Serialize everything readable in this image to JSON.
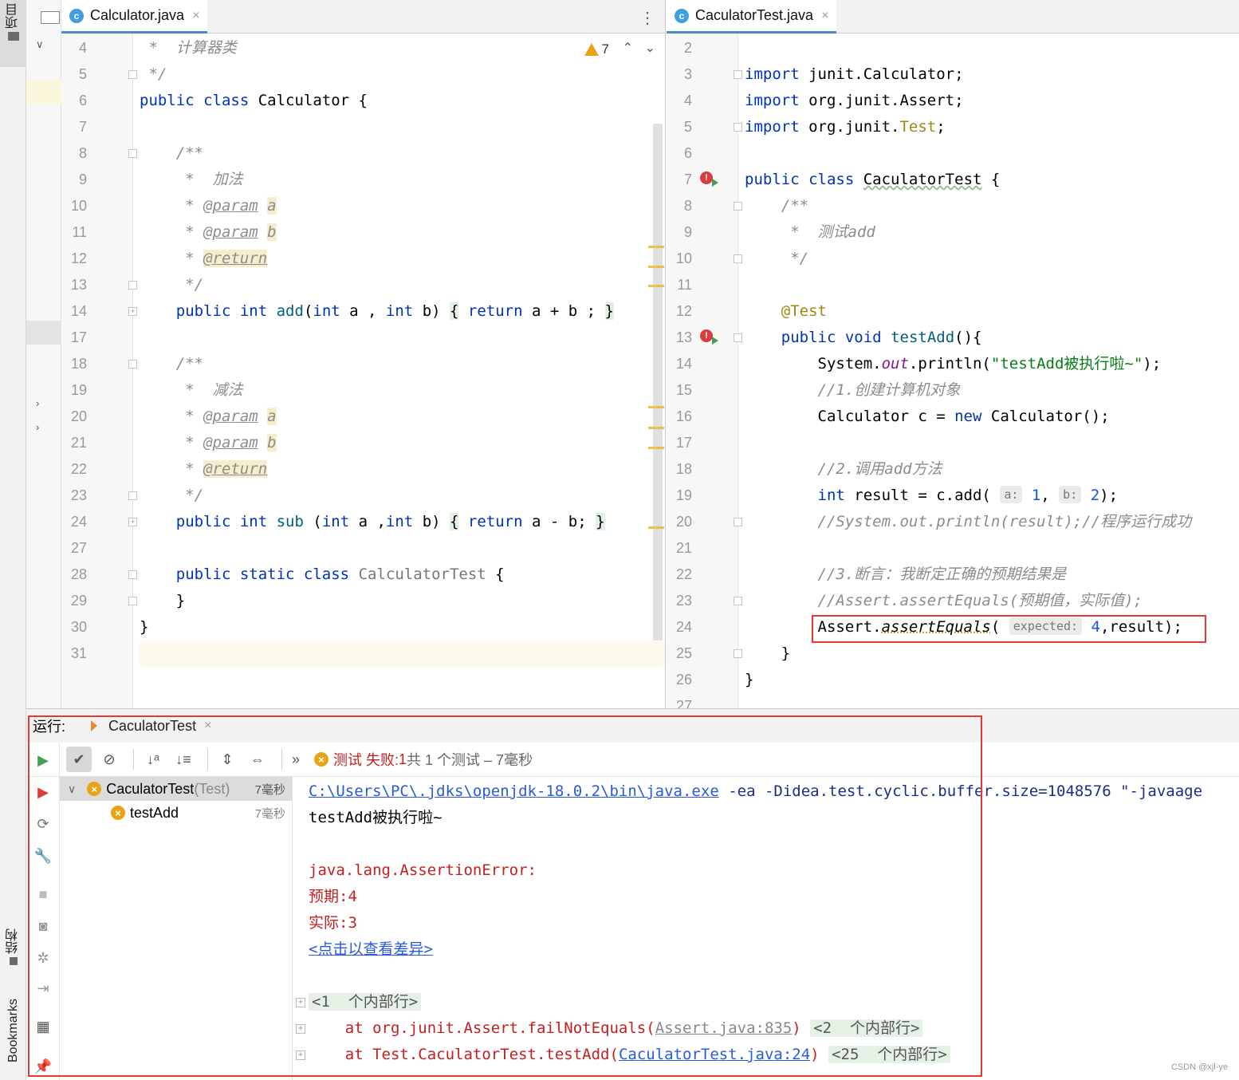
{
  "tool_strip": {
    "project_label": "项目",
    "structure_label": "结构",
    "bookmarks_label": "Bookmarks"
  },
  "left_editor": {
    "tab_title": "Calculator.java",
    "warning_count": "7",
    "lines": [
      {
        "n": "4",
        "html": "<span class='cm'> *  计算器类</span>"
      },
      {
        "n": "5",
        "html": "<span class='cm'> */</span>"
      },
      {
        "n": "6",
        "html": "<span class='kw'>public class</span> Calculator {"
      },
      {
        "n": "7",
        "html": ""
      },
      {
        "n": "8",
        "html": "    <span class='cm'>/**</span>"
      },
      {
        "n": "9",
        "html": "<span class='cm'>     *  加法</span>"
      },
      {
        "n": "10",
        "html": "<span class='cm'>     * </span><span class='tag'>@param</span> <span class='cm tagbg'>a</span>"
      },
      {
        "n": "11",
        "html": "<span class='cm'>     * </span><span class='tag'>@param</span> <span class='cm tagbg'>b</span>"
      },
      {
        "n": "12",
        "html": "<span class='cm'>     * </span><span class='tag tagbg'>@return</span>"
      },
      {
        "n": "13",
        "html": "<span class='cm'>     */</span>"
      },
      {
        "n": "14",
        "html": "    <span class='kw'>public int</span> <span class='fn'>add</span>(<span class='kw'>int</span> a , <span class='kw'>int</span> b) <span class='bracebg'>{</span> <span class='kw'>return</span> a + b ; <span class='bracebg'>}</span>"
      },
      {
        "n": "17",
        "html": ""
      },
      {
        "n": "18",
        "html": "    <span class='cm'>/**</span>"
      },
      {
        "n": "19",
        "html": "<span class='cm'>     *  减法</span>"
      },
      {
        "n": "20",
        "html": "<span class='cm'>     * </span><span class='tag'>@param</span> <span class='cm tagbg'>a</span>"
      },
      {
        "n": "21",
        "html": "<span class='cm'>     * </span><span class='tag'>@param</span> <span class='cm tagbg'>b</span>"
      },
      {
        "n": "22",
        "html": "<span class='cm'>     * </span><span class='tag tagbg'>@return</span>"
      },
      {
        "n": "23",
        "html": "<span class='cm'>     */</span>"
      },
      {
        "n": "24",
        "html": "    <span class='kw'>public int</span> <span class='fn'>sub</span> (<span class='kw'>int</span> a ,<span class='kw'>int</span> b) <span class='bracebg'>{</span> <span class='kw'>return</span> a - b; <span class='bracebg'>}</span>"
      },
      {
        "n": "27",
        "html": ""
      },
      {
        "n": "28",
        "html": "    <span class='kw'>public static class</span> <span class='gry'>CalculatorTest</span> {"
      },
      {
        "n": "29",
        "html": "    }"
      },
      {
        "n": "30",
        "html": "}"
      },
      {
        "n": "31",
        "html": ""
      }
    ]
  },
  "right_editor": {
    "tab_title": "CaculatorTest.java",
    "lines": [
      {
        "n": "2",
        "html": ""
      },
      {
        "n": "3",
        "html": "<span class='kw'>import</span> junit.Calculator;"
      },
      {
        "n": "4",
        "html": "<span class='kw'>import</span> org.junit.Assert;"
      },
      {
        "n": "5",
        "html": "<span class='kw'>import</span> org.junit.<span class='ann'>Test</span>;"
      },
      {
        "n": "6",
        "html": ""
      },
      {
        "n": "7",
        "html": "<span class='kw'>public class</span> <span style='text-decoration: underline wavy #8fbf8f;'>CaculatorTest</span> {"
      },
      {
        "n": "8",
        "html": "    <span class='cm'>/**</span>"
      },
      {
        "n": "9",
        "html": "<span class='cm'>     *  测试add</span>"
      },
      {
        "n": "10",
        "html": "<span class='cm'>     */</span>"
      },
      {
        "n": "11",
        "html": ""
      },
      {
        "n": "12",
        "html": "    <span class='ann'>@Test</span>"
      },
      {
        "n": "13",
        "html": "    <span class='kw'>public void</span> <span class='fn'>testAdd</span>(){"
      },
      {
        "n": "14",
        "html": "        System.<span class='fld'>out</span>.println(<span class='str'>\"testAdd被执行啦~\"</span>);"
      },
      {
        "n": "15",
        "html": "        <span class='cm'>//1.创建计算机对象</span>"
      },
      {
        "n": "16",
        "html": "        Calculator c = <span class='kw'>new</span> Calculator();"
      },
      {
        "n": "17",
        "html": ""
      },
      {
        "n": "18",
        "html": "        <span class='cm'>//2.调用add方法</span>"
      },
      {
        "n": "19",
        "html": "        <span class='kw'>int</span> result = c.add( <span class='hint'>a:</span> <span class='num'>1</span>, <span class='hint'>b:</span> <span class='num'>2</span>);"
      },
      {
        "n": "20",
        "html": "        <span class='cm'>//System.out.println(result);//程序运行成功</span>"
      },
      {
        "n": "21",
        "html": ""
      },
      {
        "n": "22",
        "html": "        <span class='cm'>//3.断言：我断定正确的预期结果是</span>"
      },
      {
        "n": "23",
        "html": "        <span class='cm'>//Assert.assertEquals(预期值，实际值);</span>"
      },
      {
        "n": "24",
        "html": "        Assert.<span style='font-style: italic; text-decoration: underline dotted #c9a227;'>assertEquals</span>( <span class='hint'>expected:</span> <span class='num'>4</span>,result);"
      },
      {
        "n": "25",
        "html": "    }"
      },
      {
        "n": "26",
        "html": "}"
      },
      {
        "n": "27",
        "html": ""
      }
    ]
  },
  "run_window": {
    "label": "运行:",
    "tab_title": "CaculatorTest",
    "status": {
      "fail_text": "测试 失败: ",
      "fail_count": "1",
      "summary": "共 1 个测试 – 7毫秒"
    },
    "tree": [
      {
        "name": "CaculatorTest",
        "suffix": " (Test)",
        "duration": "7毫秒"
      },
      {
        "name": "testAdd",
        "suffix": "",
        "duration": "7毫秒"
      }
    ],
    "console": {
      "java_path": "C:\\Users\\PC\\.jdks\\openjdk-18.0.2\\bin\\java.exe",
      "java_args": " -ea -Didea.test.cyclic.buffer.size=1048576 \"-javaage",
      "stdout": "testAdd被执行啦~",
      "error_class": "java.lang.AssertionError:",
      "expected_label": "预期:",
      "expected_value": "4",
      "actual_label": "实际:",
      "actual_value": "3",
      "diff_link": "<点击以查看差异>",
      "internal_1": "<1  个内部行>",
      "frame1_prefix": "    at org.junit.Assert.failNotEquals(",
      "frame1_link": "Assert.java:835",
      "frame1_suffix": ")",
      "internal_2": "<2  个内部行>",
      "frame2_prefix": "    at Test.CaculatorTest.testAdd(",
      "frame2_link": "CaculatorTest.java:24",
      "frame2_suffix": ")",
      "internal_25": "<25  个内部行>"
    }
  },
  "watermark": "CSDN @xjl-ye"
}
